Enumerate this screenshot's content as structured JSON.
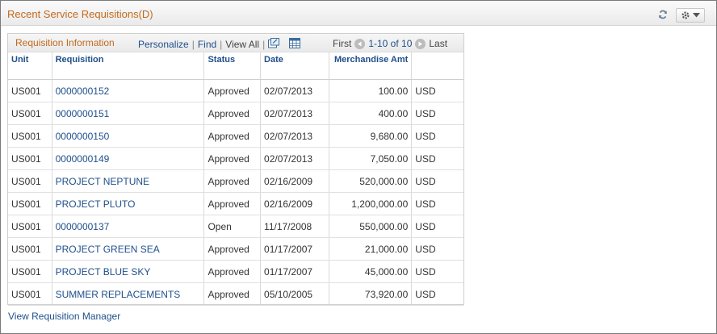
{
  "pagelet": {
    "title": "Recent Service Requisitions(D)",
    "refresh_icon": "refresh-icon",
    "menu_icon": "gear-icon"
  },
  "grid": {
    "title": "Requisition Information",
    "toolbar": {
      "personalize": "Personalize",
      "separator": "|",
      "find": "Find",
      "view_all": "View All",
      "zoom_icon": "new-window-icon",
      "download_icon": "spreadsheet-icon"
    },
    "pager": {
      "first": "First",
      "range": "1-10 of 10",
      "last": "Last"
    },
    "columns": [
      "Unit",
      "Requisition",
      "Status",
      "Date",
      "Merchandise Amt",
      ""
    ],
    "rows": [
      {
        "unit": "US001",
        "requisition": "0000000152",
        "status": "Approved",
        "date": "02/07/2013",
        "amount": "100.00",
        "currency": "USD"
      },
      {
        "unit": "US001",
        "requisition": "0000000151",
        "status": "Approved",
        "date": "02/07/2013",
        "amount": "400.00",
        "currency": "USD"
      },
      {
        "unit": "US001",
        "requisition": "0000000150",
        "status": "Approved",
        "date": "02/07/2013",
        "amount": "9,680.00",
        "currency": "USD"
      },
      {
        "unit": "US001",
        "requisition": "0000000149",
        "status": "Approved",
        "date": "02/07/2013",
        "amount": "7,050.00",
        "currency": "USD"
      },
      {
        "unit": "US001",
        "requisition": "PROJECT NEPTUNE",
        "status": "Approved",
        "date": "02/16/2009",
        "amount": "520,000.00",
        "currency": "USD"
      },
      {
        "unit": "US001",
        "requisition": "PROJECT PLUTO",
        "status": "Approved",
        "date": "02/16/2009",
        "amount": "1,200,000.00",
        "currency": "USD"
      },
      {
        "unit": "US001",
        "requisition": "0000000137",
        "status": "Open",
        "date": "11/17/2008",
        "amount": "550,000.00",
        "currency": "USD"
      },
      {
        "unit": "US001",
        "requisition": "PROJECT GREEN SEA",
        "status": "Approved",
        "date": "01/17/2007",
        "amount": "21,000.00",
        "currency": "USD"
      },
      {
        "unit": "US001",
        "requisition": "PROJECT BLUE SKY",
        "status": "Approved",
        "date": "01/17/2007",
        "amount": "45,000.00",
        "currency": "USD"
      },
      {
        "unit": "US001",
        "requisition": "SUMMER REPLACEMENTS",
        "status": "Approved",
        "date": "05/10/2005",
        "amount": "73,920.00",
        "currency": "USD"
      }
    ]
  },
  "footer": {
    "link": "View Requisition Manager"
  },
  "colors": {
    "title_orange": "#c26a1e",
    "link_blue": "#1f4f8c"
  }
}
